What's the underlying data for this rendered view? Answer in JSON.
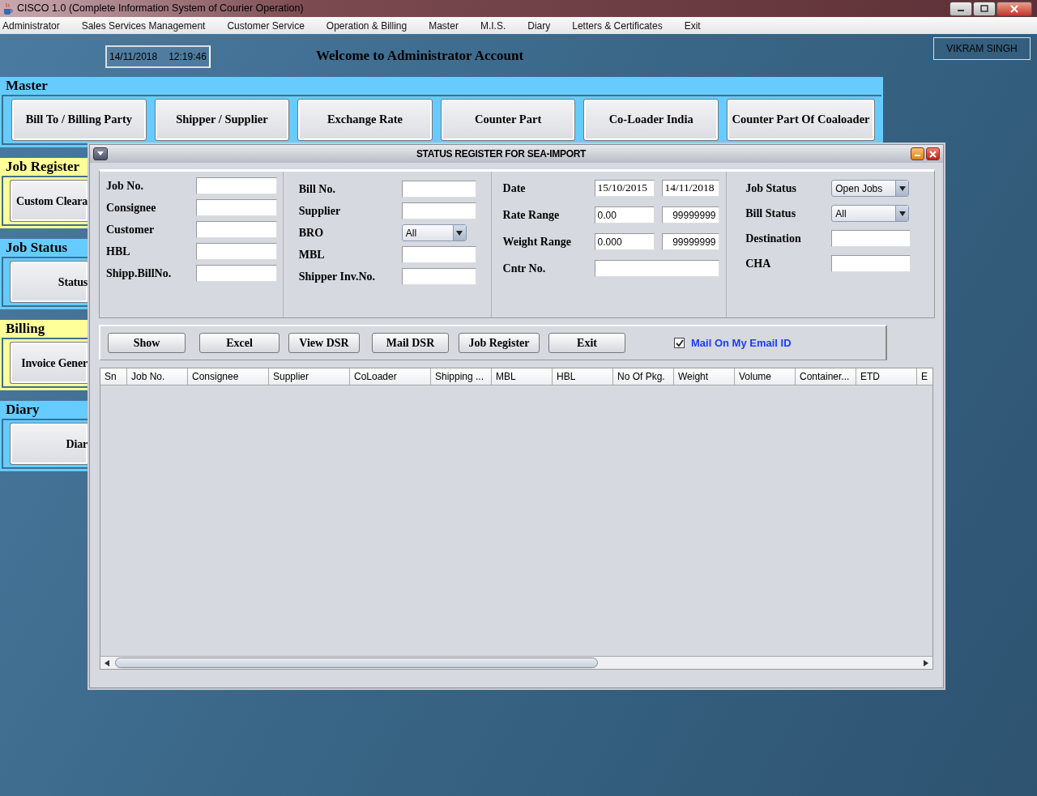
{
  "window": {
    "title": "CISCO 1.0 (Complete Information System of Courier Operation)"
  },
  "menu": [
    "Administrator",
    "Sales Services Management",
    "Customer Service",
    "Operation & Billing",
    "Master",
    "M.I.S.",
    "Diary",
    "Letters & Certificates",
    "Exit"
  ],
  "header": {
    "date": "14/11/2018",
    "time": "12:19:46",
    "welcome": "Welcome to Administrator Account",
    "user": "VIKRAM SINGH"
  },
  "sections": [
    {
      "title": "Master",
      "color": "#66ccff",
      "buttons": [
        "Bill To / Billing Party",
        "Shipper / Supplier",
        "Exchange Rate",
        "Counter Part",
        "Co-Loader India",
        "Counter Part Of Coaloader"
      ]
    },
    {
      "title": "Job Register",
      "color": "#ffff99",
      "buttons": [
        "Custom Cleara"
      ]
    },
    {
      "title": "Job Status",
      "color": "#66ccff",
      "buttons": [
        "Status"
      ]
    },
    {
      "title": "Billing",
      "color": "#ffff99",
      "buttons": [
        "Invoice Gener"
      ]
    },
    {
      "title": "Diary",
      "color": "#66ccff",
      "buttons": [
        "Diar"
      ]
    }
  ],
  "dialog": {
    "title": "STATUS REGISTER FOR SEA-IMPORT",
    "form": [
      [
        {
          "kind": "text",
          "label": "Job No."
        },
        {
          "kind": "text",
          "label": "Consignee"
        },
        {
          "kind": "text",
          "label": "Customer"
        },
        {
          "kind": "text",
          "label": "HBL"
        },
        {
          "kind": "text",
          "label": "Shipp.BillNo."
        }
      ],
      [
        {
          "kind": "text",
          "label": "Bill No."
        },
        {
          "kind": "text",
          "label": "Supplier"
        },
        {
          "kind": "select",
          "label": "BRO",
          "value": "All"
        },
        {
          "kind": "text",
          "label": "MBL"
        },
        {
          "kind": "text",
          "label": "Shipper Inv.No."
        }
      ],
      [
        {
          "kind": "pair",
          "label": "Date",
          "values": [
            "15/10/2015",
            "14/11/2018"
          ]
        },
        {
          "kind": "pair",
          "label": "Rate Range",
          "values": [
            "0.00",
            "99999999"
          ]
        },
        {
          "kind": "pair",
          "label": "Weight Range",
          "values": [
            "0.000",
            "99999999"
          ]
        },
        {
          "kind": "text",
          "label": "Cntr No."
        }
      ],
      [
        {
          "kind": "select",
          "label": "Job Status",
          "value": "Open Jobs"
        },
        {
          "kind": "select",
          "label": "Bill Status",
          "value": "All"
        },
        {
          "kind": "text",
          "label": "Destination"
        },
        {
          "kind": "text",
          "label": "CHA"
        }
      ]
    ],
    "buttons": [
      "Show",
      "Excel",
      "View DSR",
      "Mail DSR",
      "Job Register",
      "Exit"
    ],
    "mail_option": {
      "label": "Mail On My Email ID",
      "checked": true
    },
    "table": {
      "columns": [
        "Sn",
        "Job No.",
        "Consignee",
        "Supplier",
        "CoLoader",
        "Shipping ...",
        "MBL",
        "HBL",
        "No Of Pkg.",
        "Weight",
        "Volume",
        "Container...",
        "ETD",
        "E"
      ]
    }
  }
}
